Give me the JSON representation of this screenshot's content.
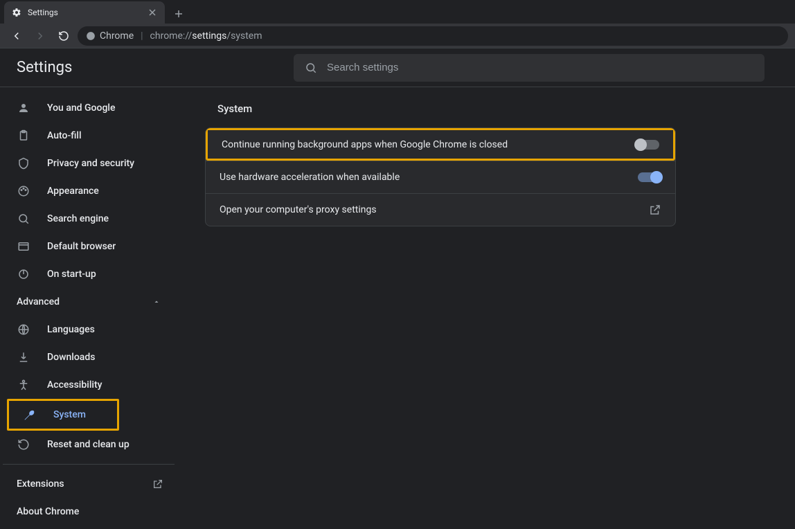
{
  "browser": {
    "tab_title": "Settings",
    "omnibox_chip": "Chrome",
    "url_prefix": "chrome://",
    "url_bold": "settings",
    "url_suffix": "/system"
  },
  "header": {
    "settings_label": "Settings",
    "search_placeholder": "Search settings"
  },
  "sidebar": {
    "items_main": [
      {
        "label": "You and Google"
      },
      {
        "label": "Auto-fill"
      },
      {
        "label": "Privacy and security"
      },
      {
        "label": "Appearance"
      },
      {
        "label": "Search engine"
      },
      {
        "label": "Default browser"
      },
      {
        "label": "On start-up"
      }
    ],
    "advanced_label": "Advanced",
    "items_advanced": [
      {
        "label": "Languages"
      },
      {
        "label": "Downloads"
      },
      {
        "label": "Accessibility"
      },
      {
        "label": "System"
      },
      {
        "label": "Reset and clean up"
      }
    ],
    "extensions_label": "Extensions",
    "about_label": "About Chrome"
  },
  "main": {
    "section_title": "System",
    "rows": [
      {
        "label": "Continue running background apps when Google Chrome is closed"
      },
      {
        "label": "Use hardware acceleration when available"
      },
      {
        "label": "Open your computer's proxy settings"
      }
    ]
  }
}
